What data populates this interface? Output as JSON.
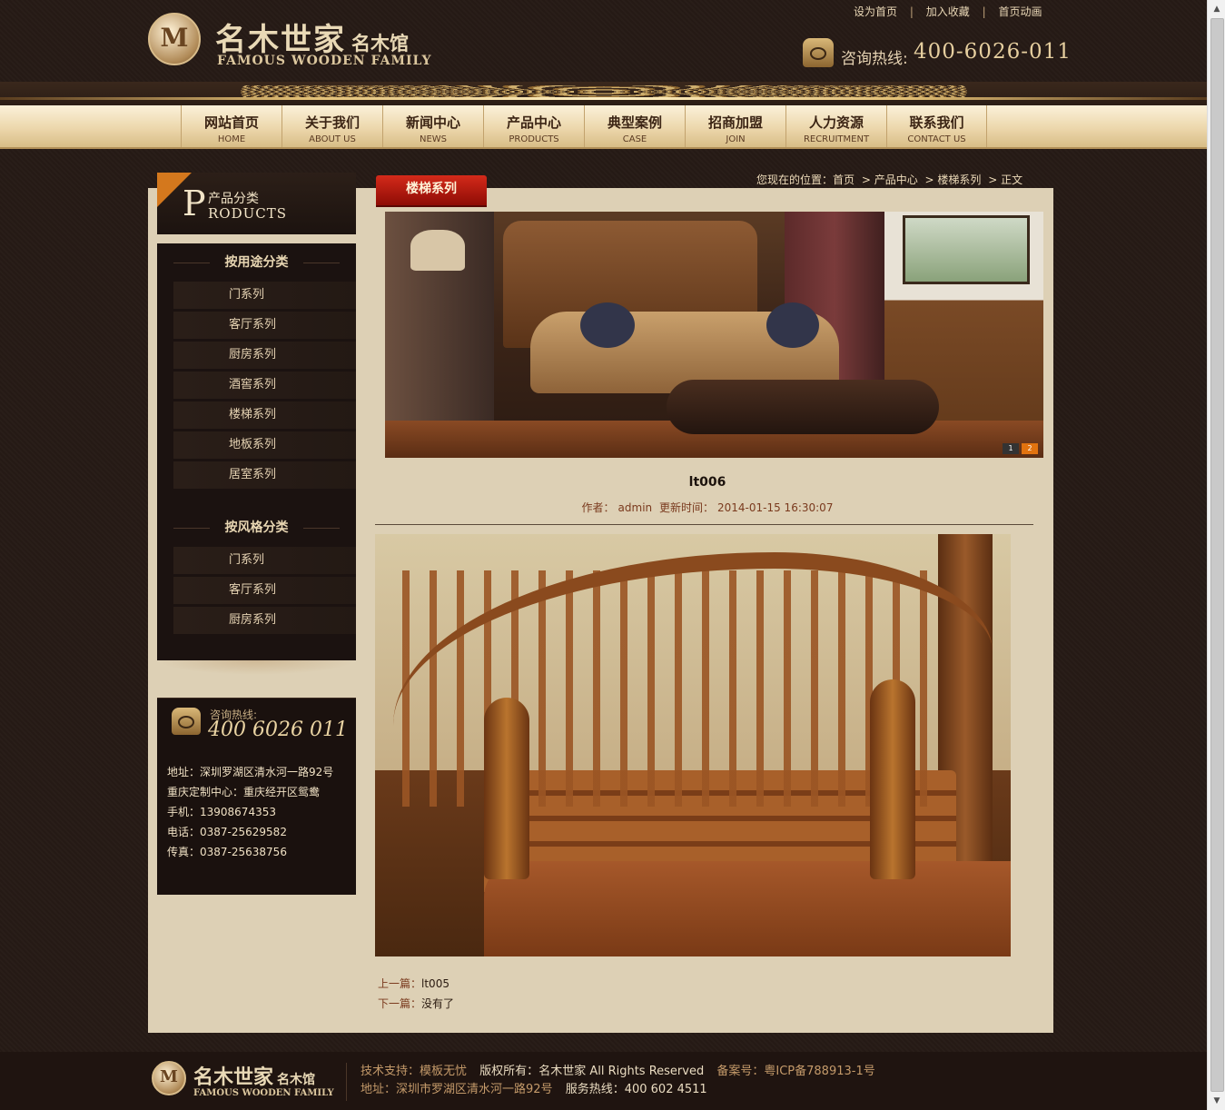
{
  "header": {
    "logo": {
      "seal": "M",
      "cn": "名木世家",
      "cn_small": "名木馆",
      "en": "FAMOUS WOODEN FAMILY"
    },
    "top_links": [
      "设为首页",
      "加入收藏",
      "首页动画"
    ],
    "top_sep": "|",
    "hotline_label": "咨询热线:",
    "hotline_number": "400-6026-011"
  },
  "nav": [
    {
      "cn": "网站首页",
      "en": "HOME"
    },
    {
      "cn": "关于我们",
      "en": "ABOUT US"
    },
    {
      "cn": "新闻中心",
      "en": "NEWS"
    },
    {
      "cn": "产品中心",
      "en": "PRODUCTS"
    },
    {
      "cn": "典型案例",
      "en": "CASE"
    },
    {
      "cn": "招商加盟",
      "en": "JOIN"
    },
    {
      "cn": "人力资源",
      "en": "RECRUITMENT"
    },
    {
      "cn": "联系我们",
      "en": "CONTACT US"
    }
  ],
  "sidebar": {
    "head_letter": "P",
    "head_cn": "产品分类",
    "head_en": "RODUCTS",
    "groups": [
      {
        "title": "按用途分类",
        "items": [
          "门系列",
          "客厅系列",
          "厨房系列",
          "酒窖系列",
          "楼梯系列",
          "地板系列",
          "居室系列"
        ]
      },
      {
        "title": "按风格分类",
        "items": [
          "门系列",
          "客厅系列",
          "厨房系列"
        ]
      }
    ]
  },
  "contact": {
    "label": "咨询热线:",
    "number": "400 6026 011",
    "lines": [
      "地址：深圳罗湖区清水河一路92号",
      "重庆定制中心：重庆经开区鸳鸯",
      "手机：13908674353",
      "电话：0387-25629582",
      "传真：0387-25638756"
    ]
  },
  "category_tab": "楼梯系列",
  "breadcrumb": [
    "您现在的位置：首页",
    "> 产品中心",
    "> 楼梯系列",
    "> 正文"
  ],
  "banner": {
    "dots": [
      "1",
      "2"
    ]
  },
  "article": {
    "title": "lt006",
    "author_label": "作者：",
    "author": "admin",
    "updated_label": "更新时间：",
    "updated": "2014-01-15 16:30:07",
    "prev_label": "上一篇：",
    "prev": "lt005",
    "next_label": "下一篇：",
    "next": "没有了"
  },
  "footer": {
    "logo_seal": "M",
    "logo_cn": "名木世家",
    "logo_cn_small": "名木馆",
    "logo_en": "FAMOUS WOODEN FAMILY",
    "tech_label": "技术支持：",
    "tech": "模板无忧",
    "copyright_label": "版权所有：",
    "copyright": "名木世家  All Rights Reserved",
    "icp_label": "备案号：",
    "icp": "粤ICP备788913-1号",
    "addr_label": "地址：",
    "addr": "深圳市罗湖区清水河一路92号",
    "service_label": "服务热线：",
    "service": "400 602 4511"
  }
}
